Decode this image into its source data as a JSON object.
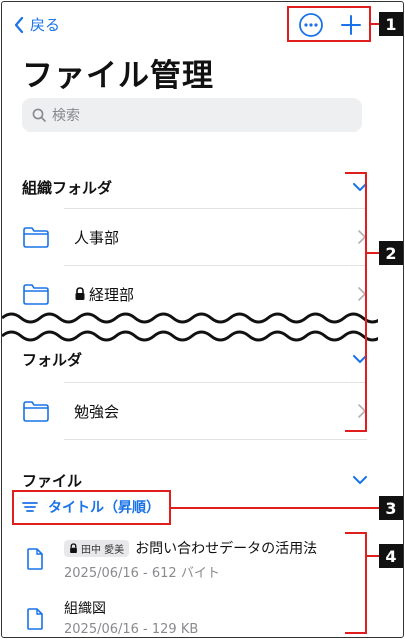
{
  "header": {
    "back_label": "戻る",
    "title": "ファイル管理"
  },
  "search": {
    "placeholder": "検索"
  },
  "org_section": {
    "title": "組織フォルダ",
    "items": [
      {
        "label": "人事部",
        "locked": false
      },
      {
        "label": "経理部",
        "locked": true
      }
    ]
  },
  "folder_section": {
    "title": "フォルダ",
    "items": [
      {
        "label": "勉強会"
      }
    ]
  },
  "file_section": {
    "title": "ファイル",
    "sort_label": "タイトル（昇順）",
    "files": [
      {
        "badge": "田中 愛美",
        "name": "お問い合わせデータの活用法",
        "meta": "2025/06/16 - 612 バイト",
        "locked": true
      },
      {
        "badge": "",
        "name": "組織図",
        "meta": "2025/06/16 - 129 KB",
        "locked": false
      }
    ]
  },
  "callouts": [
    "1",
    "2",
    "3",
    "4"
  ],
  "colors": {
    "accent": "#1a73e8",
    "annotation": "#e01e1e"
  }
}
